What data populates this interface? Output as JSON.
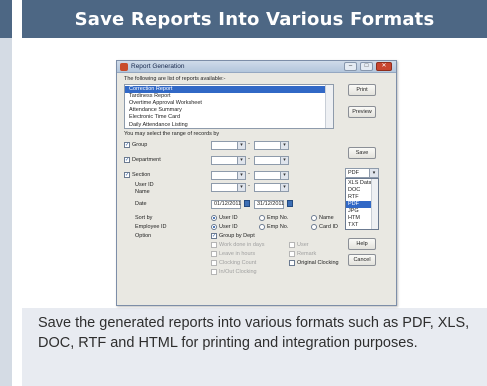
{
  "header": {
    "title": "Save Reports Into Various Formats"
  },
  "caption": "Save the generated reports into various formats such as PDF, XLS, DOC, RTF and HTML for printing and integration purposes.",
  "dialog": {
    "title": "Report Generation",
    "title_buttons": {
      "minimize": "–",
      "maximize": "□",
      "close": "✕"
    },
    "list_prompt": "The following are list of reports available:-",
    "reports": [
      "Correction Report",
      "Tardiness Report",
      "Overtime Approval Worksheet",
      "Attendance Summary",
      "Electronic Time Card",
      "Daily Attendance Listing"
    ],
    "selected_report": "Correction Report",
    "range_prompt": "You may select the range of records by",
    "filters": [
      {
        "label": "Group",
        "checked": true
      },
      {
        "label": "Department",
        "checked": true
      },
      {
        "label": "Section",
        "checked": true
      }
    ],
    "user_id_label": "User ID",
    "name_label": "Name",
    "date_label": "Date",
    "date_from": "01/12/2011",
    "date_to": "31/12/2011",
    "sort_by": {
      "label": "Sort by",
      "options": [
        "User ID",
        "Emp No.",
        "Name"
      ],
      "selected": "User ID"
    },
    "employee_id": {
      "label": "Employee ID",
      "options": [
        "User ID",
        "Emp No.",
        "Card ID"
      ],
      "selected": "User ID"
    },
    "option_label": "Option",
    "option_group_by_dept": "Group by Dept",
    "disabled_options": [
      "Work done in days",
      "Leave in hours",
      "Clocking Count",
      "In/Out Clocking",
      "User",
      "Remark"
    ],
    "original_clocking": "Original Clocking",
    "buttons": {
      "print": "Print",
      "preview": "Preview",
      "save": "Save",
      "help": "Help",
      "cancel": "Cancel"
    },
    "format_selected": "PDF",
    "formats": [
      "XLS Data",
      "DOC",
      "RTF",
      "PDF",
      "JPG",
      "HTM",
      "TXT"
    ],
    "format_highlighted": "PDF"
  }
}
